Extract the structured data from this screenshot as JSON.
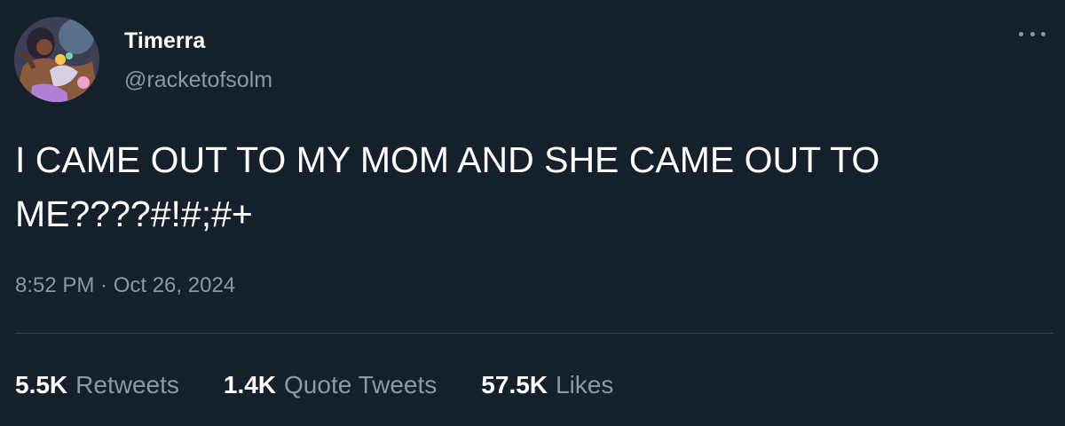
{
  "author": {
    "display_name": "Timerra",
    "handle": "@racketofsolm",
    "avatar_icon": "profile-avatar-illustration"
  },
  "tweet": {
    "text": "I CAME OUT TO MY MOM AND SHE CAME OUT TO\nME????#!#;#+",
    "timestamp": "8:52 PM · Oct 26, 2024"
  },
  "stats": {
    "retweets_count": "5.5K",
    "retweets_label": "Retweets",
    "quotes_count": "1.4K",
    "quotes_label": "Quote Tweets",
    "likes_count": "57.5K",
    "likes_label": "Likes"
  },
  "icons": {
    "more": "more-horizontal-icon"
  },
  "colors": {
    "background": "#15202b",
    "primary_text": "#ffffff",
    "secondary_text": "#8b98a5",
    "divider": "#38444d"
  }
}
